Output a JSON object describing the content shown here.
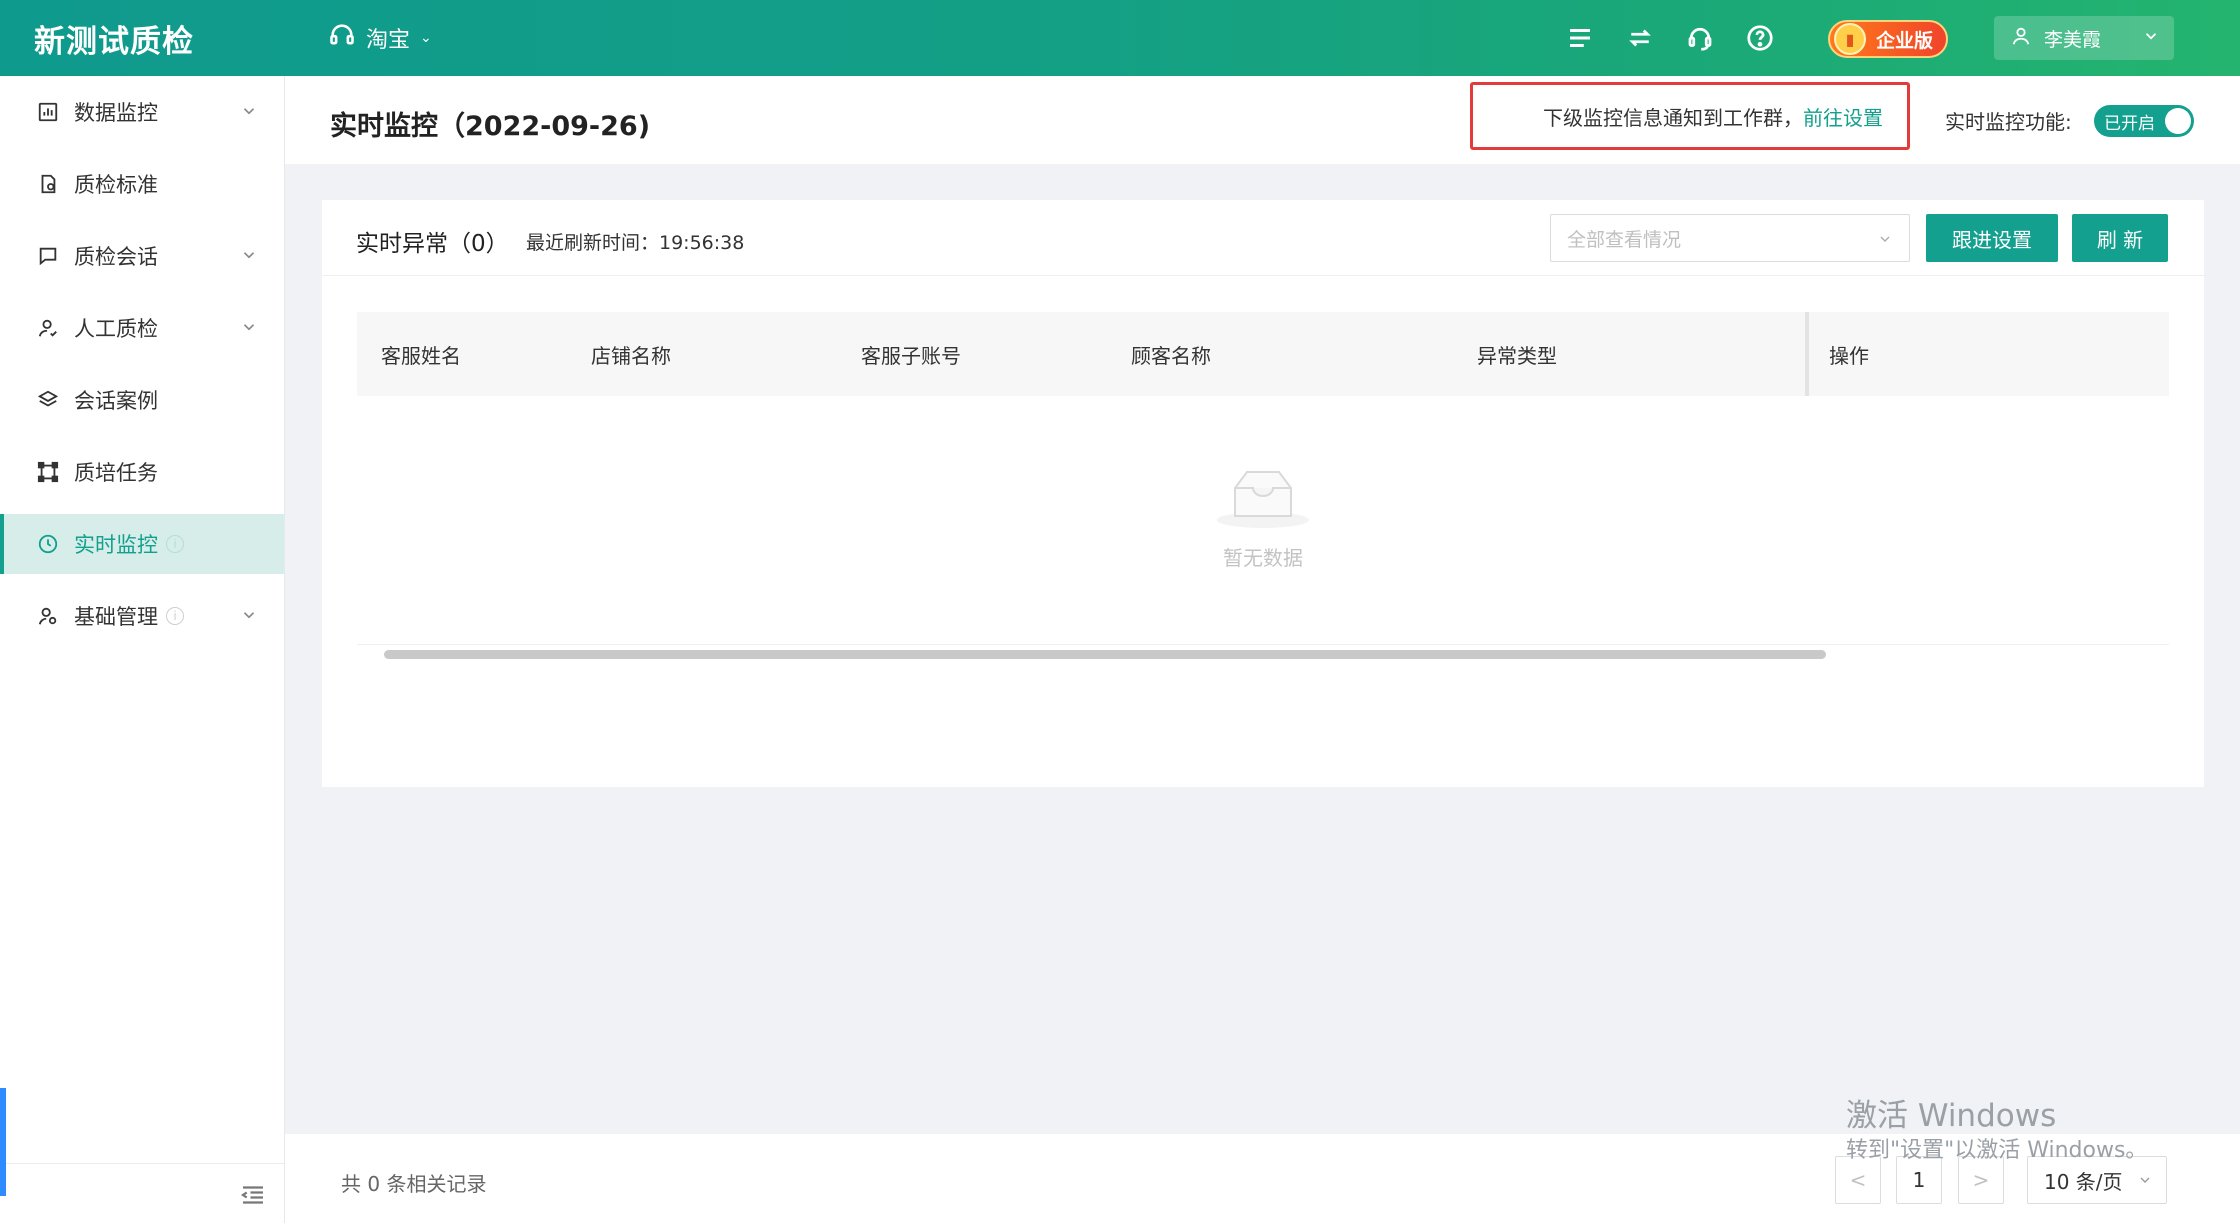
{
  "header": {
    "brand": "新测试质检",
    "platform": "淘宝",
    "enterprise_badge": "企业版",
    "username": "李美霞",
    "icons": [
      "list-icon",
      "swap-icon",
      "headset-icon",
      "help-icon"
    ]
  },
  "sidebar": {
    "items": [
      {
        "label": "数据监控",
        "icon": "bar-chart-icon",
        "has_arrow": true
      },
      {
        "label": "质检标准",
        "icon": "doc-check-icon",
        "has_arrow": false
      },
      {
        "label": "质检会话",
        "icon": "chat-icon",
        "has_arrow": true
      },
      {
        "label": "人工质检",
        "icon": "person-icon",
        "has_arrow": true
      },
      {
        "label": "会话案例",
        "icon": "layers-icon",
        "has_arrow": false
      },
      {
        "label": "质培任务",
        "icon": "frame-icon",
        "has_arrow": false
      },
      {
        "label": "实时监控",
        "icon": "clock-icon",
        "has_arrow": false,
        "active": true,
        "info": "i"
      },
      {
        "label": "基础管理",
        "icon": "user-settings-icon",
        "has_arrow": true,
        "info": "i"
      }
    ]
  },
  "titlebar": {
    "title": "实时监控（2022-09-26)",
    "notice_text": "下级监控信息通知到工作群，",
    "notice_link": "前往设置",
    "monitor_label": "实时监控功能:",
    "switch_label": "已开启"
  },
  "card": {
    "title": "实时异常（0）",
    "refresh_time": "最近刷新时间：19:56:38",
    "select_placeholder": "全部查看情况",
    "follow_button": "跟进设置",
    "refresh_button": "刷 新",
    "columns": [
      "客服姓名",
      "店铺名称",
      "客服子账号",
      "顾客名称",
      "异常类型",
      "操作"
    ],
    "empty_text": "暂无数据"
  },
  "footer": {
    "total": "共 0 条相关记录",
    "prev": "<",
    "page": "1",
    "next": ">",
    "page_size": "10 条/页"
  },
  "watermark": {
    "line1": "激活 Windows",
    "line2": "转到\"设置\"以激活 Windows。"
  },
  "colors": {
    "accent": "#13a08e",
    "header_gradient_start": "#0f9a8e",
    "header_gradient_end": "#24b46f",
    "highlight_border": "#e33a3a"
  }
}
